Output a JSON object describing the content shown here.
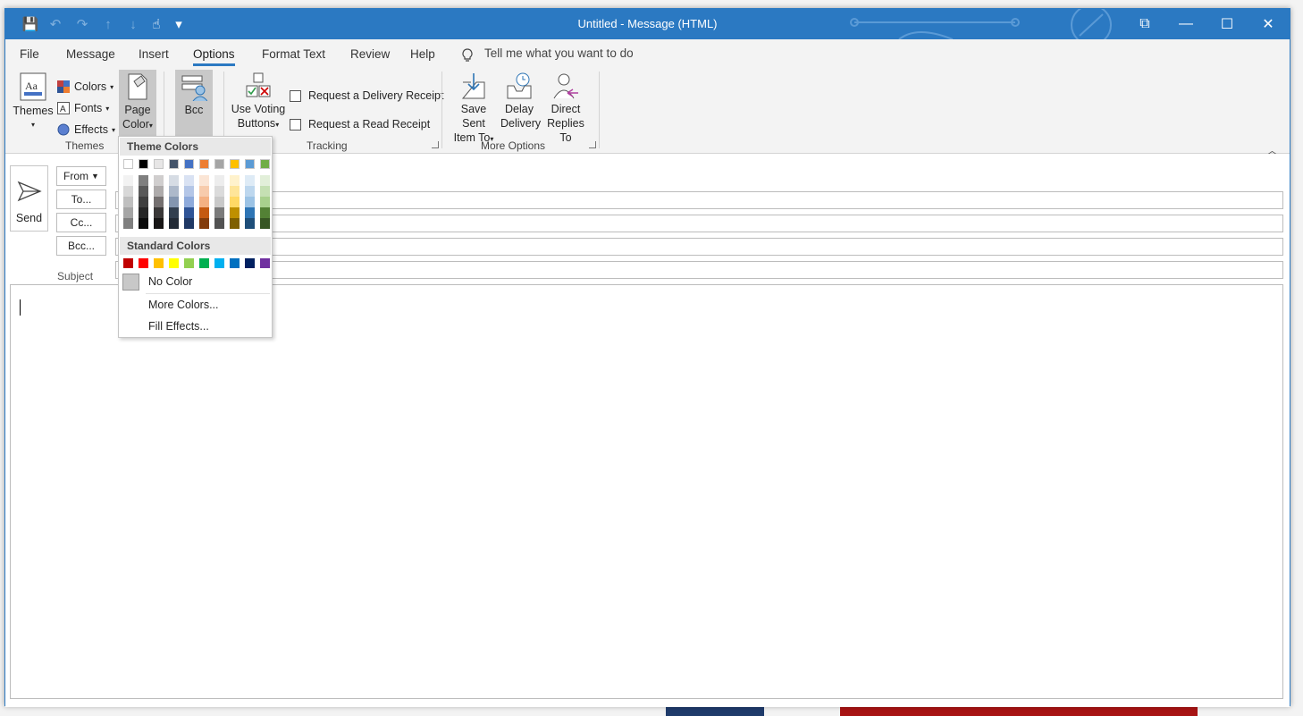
{
  "window": {
    "title": "Untitled  -  Message (HTML)"
  },
  "quick_access": [
    {
      "icon": "save-icon",
      "glyph": "💾"
    },
    {
      "icon": "undo-icon",
      "glyph": "↶"
    },
    {
      "icon": "redo-icon",
      "glyph": "↷"
    },
    {
      "icon": "up-arrow-icon",
      "glyph": "↑"
    },
    {
      "icon": "down-arrow-icon",
      "glyph": "↓"
    },
    {
      "icon": "touch-mode-icon",
      "glyph": "☝"
    },
    {
      "icon": "customize-qat-icon",
      "glyph": "▾"
    }
  ],
  "window_controls": {
    "ribbon_display": "⧉",
    "minimize": "—",
    "maximize": "☐",
    "close": "✕"
  },
  "tabs": [
    "File",
    "Message",
    "Insert",
    "Options",
    "Format Text",
    "Review",
    "Help"
  ],
  "active_tab": "Options",
  "tell_me": "Tell me what you want to do",
  "ribbon": {
    "themes_group": {
      "label": "Themes",
      "themes_btn": "Themes",
      "colors_btn": "Colors",
      "fonts_btn": "Fonts",
      "effects_btn": "Effects",
      "page_color_line1": "Page",
      "page_color_line2": "Color"
    },
    "show_fields": {
      "bcc_btn": "Bcc"
    },
    "tracking_group": {
      "label": "Tracking",
      "voting_line1": "Use Voting",
      "voting_line2": "Buttons",
      "delivery_receipt": "Request a Delivery Receipt",
      "read_receipt": "Request a Read Receipt"
    },
    "more_options_group": {
      "label": "More Options",
      "save_sent_line1": "Save Sent",
      "save_sent_line2": "Item To",
      "delay_line1": "Delay",
      "delay_line2": "Delivery",
      "direct_line1": "Direct",
      "direct_line2": "Replies To"
    }
  },
  "compose": {
    "send": "Send",
    "from": "From",
    "to": "To...",
    "cc": "Cc...",
    "bcc": "Bcc...",
    "subject": "Subject"
  },
  "page_color_menu": {
    "theme_colors_header": "Theme Colors",
    "standard_colors_header": "Standard Colors",
    "theme_base": [
      "#FFFFFF",
      "#000000",
      "#E7E6E6",
      "#44546A",
      "#4472C4",
      "#ED7D31",
      "#A5A5A5",
      "#FFC000",
      "#5B9BD5",
      "#70AD47"
    ],
    "theme_shades": [
      [
        "#F2F2F2",
        "#7F7F7F",
        "#D0CECE",
        "#D6DCE4",
        "#D9E2F3",
        "#FBE5D5",
        "#EDEDED",
        "#FFF2CC",
        "#DEEBF6",
        "#E2EFD9"
      ],
      [
        "#D8D8D8",
        "#595959",
        "#AEABAB",
        "#ADB9CA",
        "#B4C6E7",
        "#F7CBAC",
        "#DBDBDB",
        "#FEE599",
        "#BDD7EE",
        "#C5E0B3"
      ],
      [
        "#BFBFBF",
        "#3F3F3F",
        "#757070",
        "#8496B0",
        "#8EAADB",
        "#F4B183",
        "#C9C9C9",
        "#FFD965",
        "#9CC3E5",
        "#A8D08D"
      ],
      [
        "#A5A5A5",
        "#262626",
        "#3A3838",
        "#323F4F",
        "#2F5496",
        "#C55A11",
        "#7B7B7B",
        "#BF9000",
        "#2E75B5",
        "#538135"
      ],
      [
        "#7F7F7F",
        "#0C0C0C",
        "#171616",
        "#222A35",
        "#1F3864",
        "#833C0B",
        "#525252",
        "#7F6000",
        "#1E4E79",
        "#375623"
      ]
    ],
    "standard": [
      "#C00000",
      "#FF0000",
      "#FFC000",
      "#FFFF00",
      "#92D050",
      "#00B050",
      "#00B0F0",
      "#0070C0",
      "#002060",
      "#7030A0"
    ],
    "no_color": "No Color",
    "more_colors": "More Colors...",
    "fill_effects": "Fill Effects..."
  }
}
